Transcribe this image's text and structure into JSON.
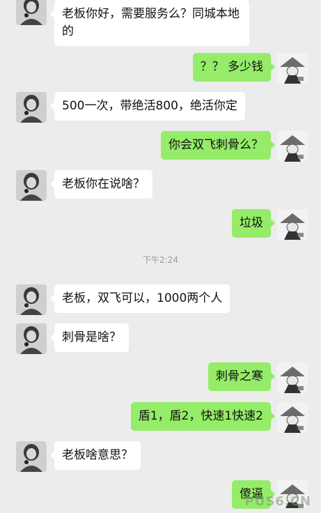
{
  "messages": [
    {
      "side": "left",
      "text": "老板你好，需要服务么？同城本地的"
    },
    {
      "side": "right",
      "text": "？？ 多少钱"
    },
    {
      "side": "left",
      "text": "500一次，带绝活800，绝活你定"
    },
    {
      "side": "right",
      "text": "你会双飞刺骨么？"
    },
    {
      "side": "left",
      "text": "老板你在说啥？"
    },
    {
      "side": "right",
      "text": "垃圾"
    },
    {
      "side": "left",
      "text": "老板，双飞可以，1000两个人"
    },
    {
      "side": "left",
      "text": "刺骨是啥？"
    },
    {
      "side": "right",
      "text": "刺骨之寒"
    },
    {
      "side": "right",
      "text": "盾1，盾2，快速1快速2"
    },
    {
      "side": "left",
      "text": "老板啥意思？"
    },
    {
      "side": "right",
      "text": "傻逼"
    }
  ],
  "timestamp": "下午2:24",
  "watermark": "PUS6.CN",
  "colors": {
    "background": "#ececec",
    "bubble_left": "#ffffff",
    "bubble_right": "#95ec69"
  },
  "icons": {
    "left_avatar": "portrait-avatar-icon",
    "right_avatar": "straw-hat-avatar-icon"
  }
}
